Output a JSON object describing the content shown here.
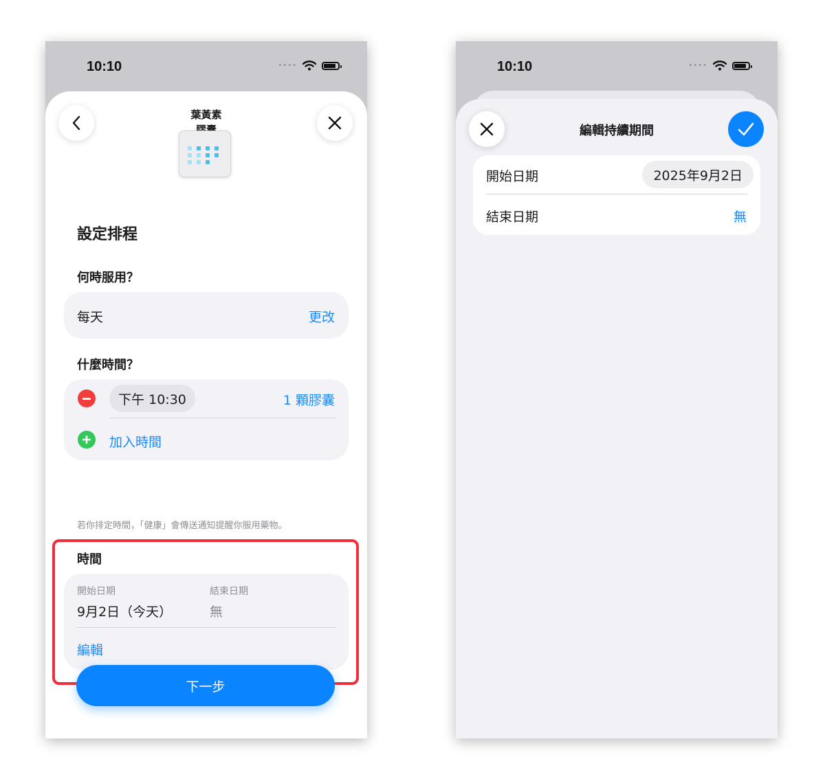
{
  "left": {
    "status": {
      "time": "10:10"
    },
    "med": {
      "name_line1": "葉黃素",
      "name_line2": "膠囊"
    },
    "title": "設定排程",
    "when": {
      "label": "何時服用？",
      "frequency": "每天",
      "change_label": "更改"
    },
    "what_time": {
      "label": "什麼時間？",
      "time": "下午 10:30",
      "dose": "1 顆膠囊",
      "add_label": "加入時間"
    },
    "note": "若你排定時間，「健康」會傳送通知提醒你服用藥物。",
    "duration": {
      "label": "時間",
      "start_label": "開始日期",
      "start_value": "9月2日（今天）",
      "end_label": "結束日期",
      "end_value": "無",
      "edit_label": "編輯"
    },
    "next_label": "下一步"
  },
  "right": {
    "status": {
      "time": "10:10"
    },
    "title": "編輯持續期間",
    "start_label": "開始日期",
    "start_value": "2025年9月2日",
    "end_label": "結束日期",
    "end_value": "無"
  },
  "colors": {
    "accent": "#0a84ff",
    "link": "#1a8cff",
    "highlight": "#ef2e3a",
    "remove": "#f23d3d",
    "add": "#34c759",
    "card": "#f2f2f7"
  },
  "icons": [
    "back-chevron-icon",
    "close-icon",
    "pill-box-icon",
    "remove-circle-icon",
    "add-circle-icon",
    "checkmark-icon",
    "wifi-icon",
    "battery-icon",
    "signal-icon"
  ]
}
